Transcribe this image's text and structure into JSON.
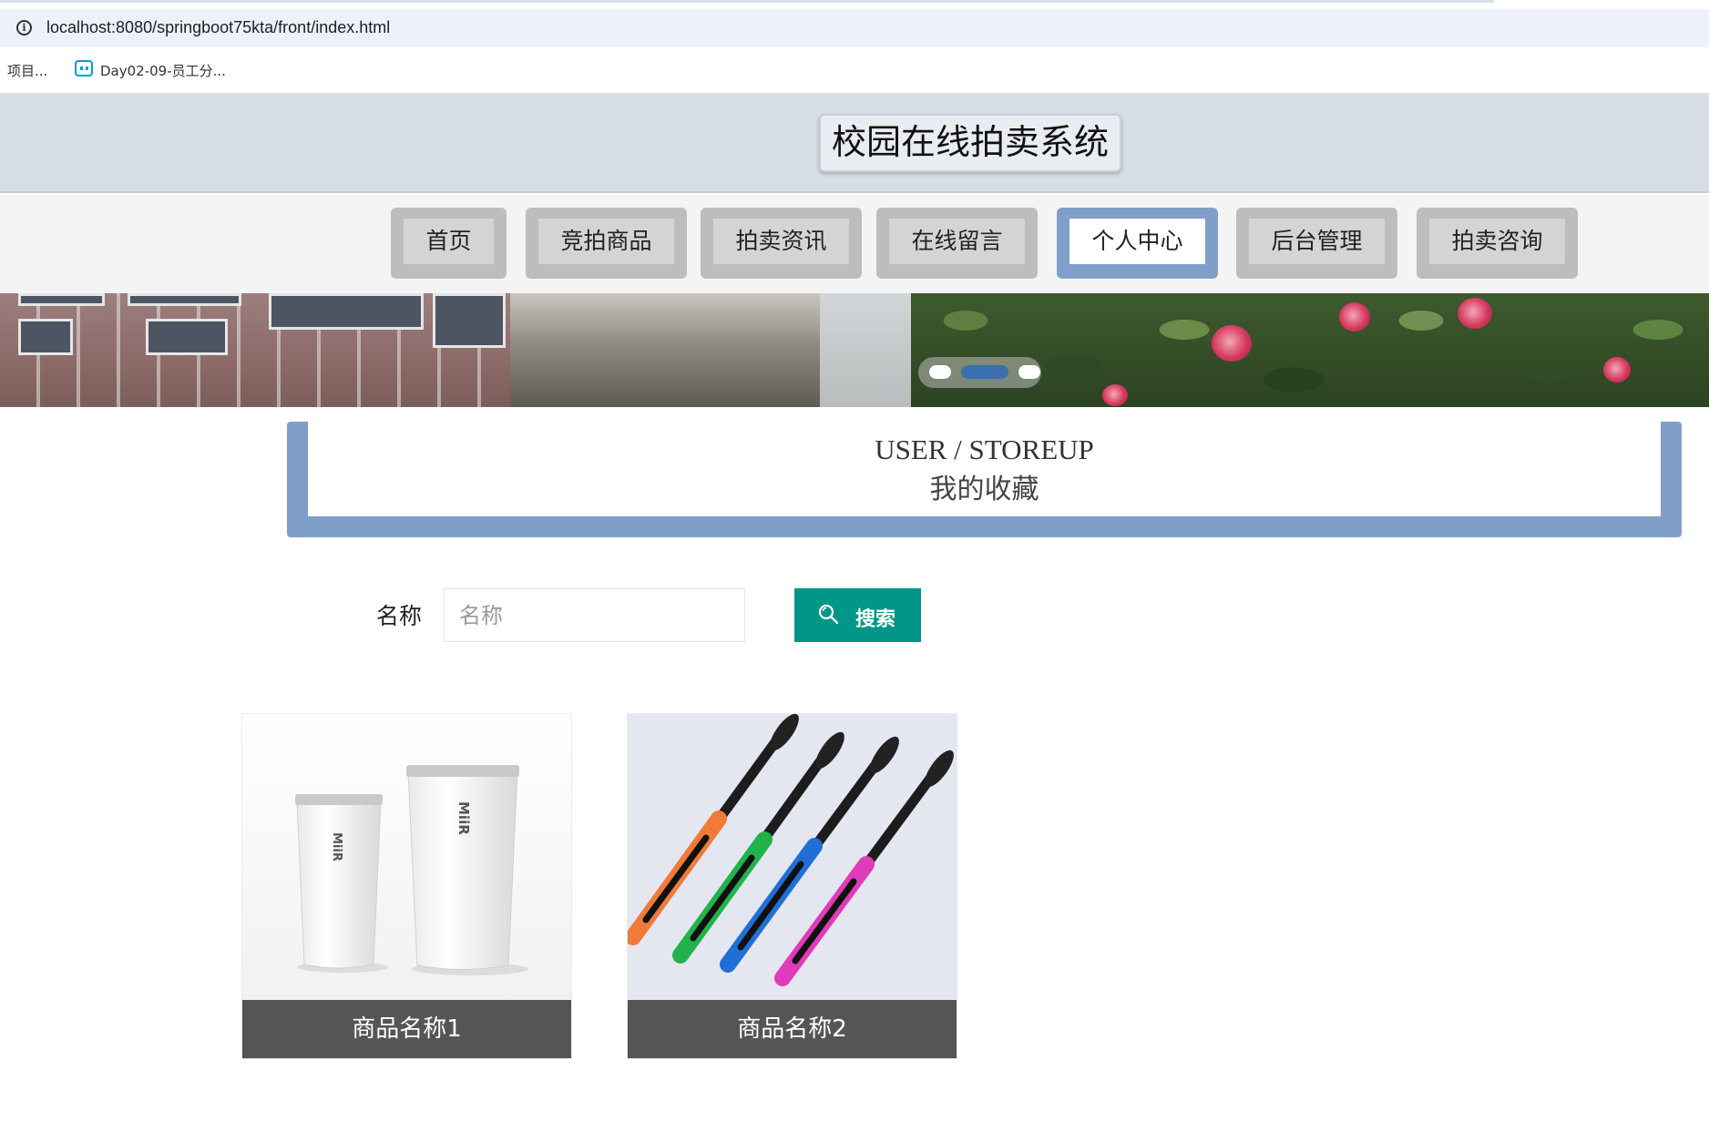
{
  "browser": {
    "url": "localhost:8080/springboot75kta/front/index.html",
    "bookmarks": [
      {
        "label": "项目..."
      },
      {
        "label": "Day02-09-员工分..."
      }
    ]
  },
  "header": {
    "title": "校园在线拍卖系统"
  },
  "nav": {
    "items": [
      {
        "label": "首页"
      },
      {
        "label": "竞拍商品"
      },
      {
        "label": "拍卖资讯"
      },
      {
        "label": "在线留言"
      },
      {
        "label": "个人中心"
      },
      {
        "label": "后台管理"
      },
      {
        "label": "拍卖咨询"
      }
    ],
    "active_index": 4
  },
  "carousel": {
    "slide_count": 3,
    "active_index": 1
  },
  "section": {
    "title_en": "USER / STOREUP",
    "title_cn": "我的收藏"
  },
  "search": {
    "label": "名称",
    "placeholder": "名称",
    "value": "",
    "button_label": "搜索"
  },
  "products": [
    {
      "name": "商品名称1"
    },
    {
      "name": "商品名称2"
    }
  ],
  "colors": {
    "accent_blue": "#7f9fc8",
    "search_button": "#009688",
    "caption_bg": "#555555",
    "header_bg": "#d7dee7"
  }
}
